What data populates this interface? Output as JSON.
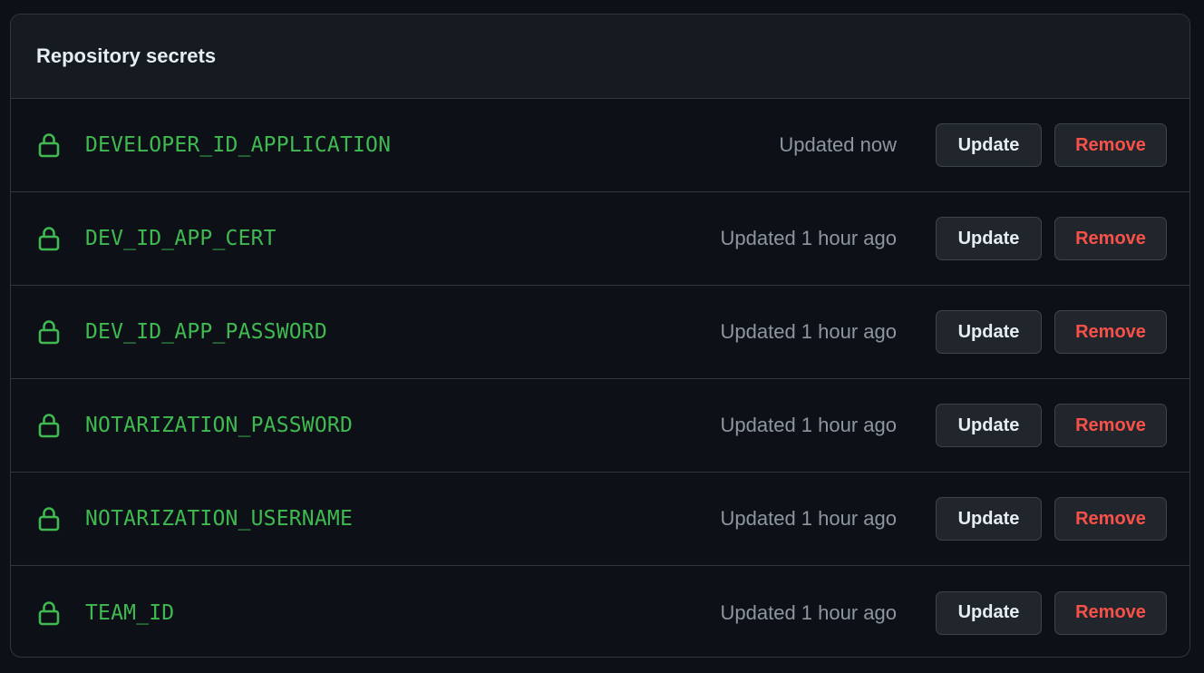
{
  "panel": {
    "title": "Repository secrets"
  },
  "secrets": [
    {
      "name": "DEVELOPER_ID_APPLICATION",
      "updated": "Updated now",
      "update_label": "Update",
      "remove_label": "Remove"
    },
    {
      "name": "DEV_ID_APP_CERT",
      "updated": "Updated 1 hour ago",
      "update_label": "Update",
      "remove_label": "Remove"
    },
    {
      "name": "DEV_ID_APP_PASSWORD",
      "updated": "Updated 1 hour ago",
      "update_label": "Update",
      "remove_label": "Remove"
    },
    {
      "name": "NOTARIZATION_PASSWORD",
      "updated": "Updated 1 hour ago",
      "update_label": "Update",
      "remove_label": "Remove"
    },
    {
      "name": "NOTARIZATION_USERNAME",
      "updated": "Updated 1 hour ago",
      "update_label": "Update",
      "remove_label": "Remove"
    },
    {
      "name": "TEAM_ID",
      "updated": "Updated 1 hour ago",
      "update_label": "Update",
      "remove_label": "Remove"
    }
  ],
  "icons": {
    "secret": "lock-icon"
  },
  "colors": {
    "background": "#0d1117",
    "header_background": "#161b22",
    "border": "#30363d",
    "secret_name": "#3fb950",
    "muted_text": "#8d96a0",
    "danger": "#f85149",
    "button_background": "#21262d"
  }
}
